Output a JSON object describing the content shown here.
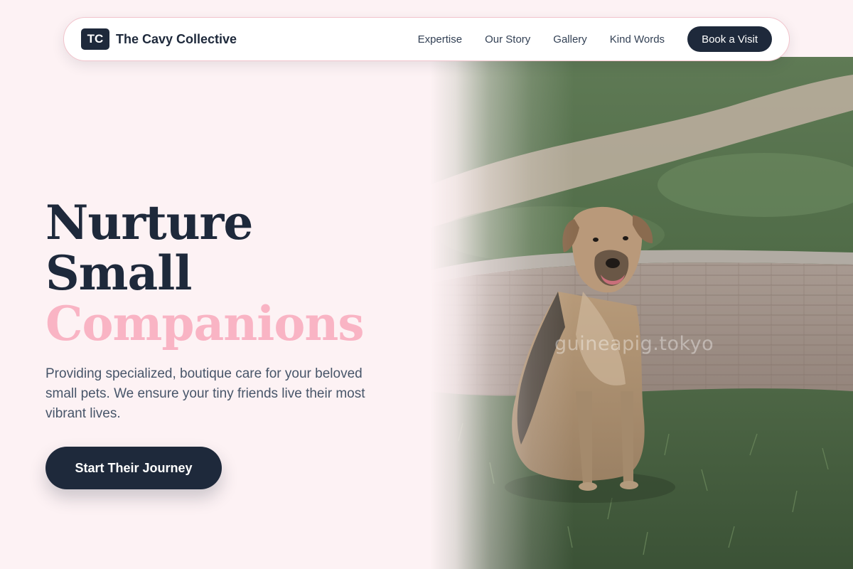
{
  "nav": {
    "logo_badge": "TC",
    "brand_name": "The Cavy Collective",
    "links": [
      {
        "label": "Expertise"
      },
      {
        "label": "Our Story"
      },
      {
        "label": "Gallery"
      },
      {
        "label": "Kind Words"
      }
    ],
    "cta_label": "Book a Visit"
  },
  "hero": {
    "headline_line1": "Nurture",
    "headline_line2": "Small",
    "headline_line3": "Companions",
    "lead": "Providing specialized, boutique care for your beloved small pets. We ensure your tiny friends live their most vibrant lives.",
    "cta_label": "Start Their Journey",
    "image_watermark": "guineapig.tokyo"
  },
  "colors": {
    "background": "#fdf2f4",
    "navy": "#1e293b",
    "accent_pink": "#f9b4c4"
  }
}
